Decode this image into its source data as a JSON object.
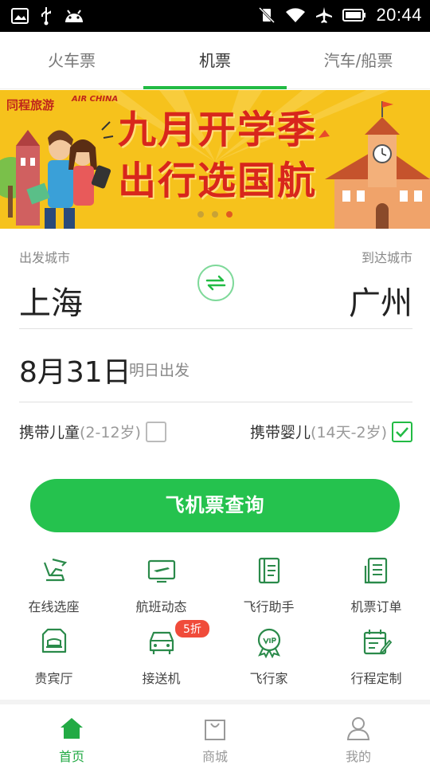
{
  "status_bar": {
    "time": "20:44",
    "icons": [
      "image-icon",
      "usb-icon",
      "android-icon",
      "vibrate-off-icon",
      "wifi-icon",
      "airplane-icon",
      "battery-icon"
    ]
  },
  "tabs": [
    {
      "label": "火车票",
      "active": false
    },
    {
      "label": "机票",
      "active": true
    },
    {
      "label": "汽车/船票",
      "active": false
    }
  ],
  "banner": {
    "logo1": "同程旅游",
    "logo2": "AIR CHINA",
    "title_line1": "九月开学季",
    "title_line2": "出行选国航",
    "dots": 3,
    "active_dot": 2
  },
  "form": {
    "from_label": "出发城市",
    "to_label": "到达城市",
    "from_city": "上海",
    "to_city": "广州",
    "date": "8月31日",
    "date_note": "明日出发",
    "child_label": "携带儿童",
    "child_range": "(2-12岁)",
    "child_checked": false,
    "infant_label": "携带婴儿",
    "infant_range": "(14天-2岁)",
    "infant_checked": true
  },
  "search_button": "飞机票查询",
  "services": [
    {
      "label": "在线选座",
      "icon": "seat-icon"
    },
    {
      "label": "航班动态",
      "icon": "flight-status-icon"
    },
    {
      "label": "飞行助手",
      "icon": "assistant-book-icon"
    },
    {
      "label": "机票订单",
      "icon": "order-list-icon"
    },
    {
      "label": "贵宾厅",
      "icon": "lounge-icon"
    },
    {
      "label": "接送机",
      "icon": "car-icon",
      "badge": "5折"
    },
    {
      "label": "飞行家",
      "icon": "vip-badge-icon"
    },
    {
      "label": "行程定制",
      "icon": "calendar-edit-icon"
    }
  ],
  "bottom_nav": [
    {
      "label": "首页",
      "icon": "home-icon",
      "active": true
    },
    {
      "label": "商城",
      "icon": "shopping-bag-icon",
      "active": false
    },
    {
      "label": "我的",
      "icon": "user-icon",
      "active": false
    }
  ],
  "colors": {
    "accent": "#25c24e",
    "banner_bg": "#f6c21c",
    "banner_text": "#d8261c",
    "badge": "#f04b3a"
  }
}
